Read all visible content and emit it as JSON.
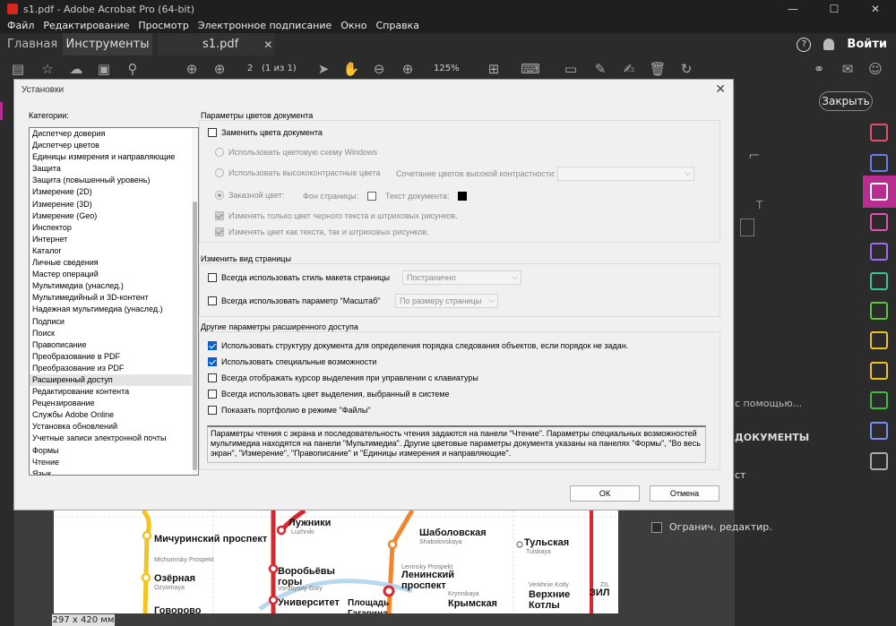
{
  "window": {
    "title": "s1.pdf - Adobe Acrobat Pro (64-bit)",
    "controls": [
      "—",
      "☐",
      "✕"
    ]
  },
  "menu": [
    "Файл",
    "Редактирование",
    "Просмотр",
    "Электронное подписание",
    "Окно",
    "Справка"
  ],
  "tabs": {
    "home": "Главная",
    "tools": "Инструменты",
    "file": "s1.pdf",
    "file_close": "✕",
    "help": "?",
    "signin": "Войти"
  },
  "toolbar": {
    "page_number": "2",
    "page_count": "(1 из 1)",
    "zoom": "125%"
  },
  "right_pane": {
    "close_label": "Закрыть",
    "text_search_hint": "с помощью...",
    "section_heading": "ДОКУМЕНТЫ",
    "item_partial": "ст",
    "restrict_edit": "Огранич. редактир."
  },
  "document": {
    "page_size": "297 x 420 мм",
    "stations": [
      {
        "name": "Мичуринский проспект",
        "sub": "Michurinsky Prospekt"
      },
      {
        "name": "Озёрная",
        "sub": "Ozyornaya"
      },
      {
        "name": "Говорово",
        "sub": ""
      },
      {
        "name": "Лужники",
        "sub": "Luzhniki"
      },
      {
        "name": "Воробьёвы горы",
        "sub": "Vorobyovy Gory"
      },
      {
        "name": "Университет",
        "sub": ""
      },
      {
        "name": "Шаболовская",
        "sub": "Shabolovskaya"
      },
      {
        "name": "Ленинский проспект",
        "sub": "Leninsky Prospekt"
      },
      {
        "name": "Площадь Гагарина",
        "sub": ""
      },
      {
        "name": "Крымская",
        "sub": "Krymskaya"
      },
      {
        "name": "Тульская",
        "sub": "Tulskaya"
      },
      {
        "name": "Верхние Котлы",
        "sub": "Verkhnie Kotly"
      },
      {
        "name": "ЗИЛ",
        "sub": "ZIL"
      }
    ]
  },
  "dialog": {
    "title": "Установки",
    "close": "✕",
    "categories_label": "Категории:",
    "categories": [
      "Диспетчер доверия",
      "Диспетчер цветов",
      "Единицы измерения и направляющие",
      "Защита",
      "Защита (повышенный уровень)",
      "Измерение (2D)",
      "Измерение (3D)",
      "Измерение (Geo)",
      "Инспектор",
      "Интернет",
      "Каталог",
      "Личные сведения",
      "Мастер операций",
      "Мультимедиа (унаслед.)",
      "Мультимедийный и 3D-контент",
      "Надежная мультимедиа (унаслед.)",
      "Подписи",
      "Поиск",
      "Правописание",
      "Преобразование в PDF",
      "Преобразование из PDF",
      "Расширенный доступ",
      "Редактирование контента",
      "Рецензирование",
      "Службы Adobe Online",
      "Установка обновлений",
      "Учетные записи электронной почты",
      "Формы",
      "Чтение",
      "Язык"
    ],
    "selected_category": "Расширенный доступ",
    "color_group": {
      "title": "Параметры цветов документа",
      "replace_colors": "Заменить цвета документа",
      "windows_scheme": "Использовать цветовую схему Windows",
      "high_contrast": "Использовать высококонтрастные цвета",
      "hc_combo_label": "Сочетание цветов высокой контрастности:",
      "hc_combo_value": "",
      "custom_color": "Заказной цвет:",
      "page_bg_label": "Фон страницы:",
      "doc_text_label": "Текст документа:",
      "page_bg_color": "#ffffff",
      "doc_text_color": "#000000",
      "only_black_text": "Изменять только цвет черного текста и штриховых рисунков.",
      "text_and_lines": "Изменять цвет как текста, так и штриховых рисунков."
    },
    "view_group": {
      "title": "Изменить вид страницы",
      "always_layout": "Всегда использовать стиль макета страницы",
      "layout_value": "Постранично",
      "always_zoom": "Всегда использовать параметр \"Масштаб\"",
      "zoom_value": "По размеру страницы"
    },
    "other_group": {
      "title": "Другие параметры расширенного доступа",
      "items": [
        {
          "label": "Использовать структуру документа для определения порядка следования объектов, если порядок не задан.",
          "checked": true
        },
        {
          "label": "Использовать специальные возможности",
          "checked": true
        },
        {
          "label": "Всегда отображать курсор выделения при управлении с клавиатуры",
          "checked": false
        },
        {
          "label": "Всегда использовать цвет выделения, выбранный в системе",
          "checked": false
        },
        {
          "label": "Показать портфолио в режиме \"Файлы\"",
          "checked": false
        }
      ],
      "info": "Параметры чтения с экрана и последовательность чтения задаются на панели \"Чтение\". Параметры специальных возможностей мультимедиа находятся на панели \"Мультимедиа\". Другие цветовые параметры документа указаны на панелях \"Формы\", \"Во весь экран\", \"Измерение\", \"Правописание\" и \"Единицы измерения и направляющие\"."
    },
    "ok": "ОК",
    "cancel": "Отмена"
  },
  "colors": {
    "accent_checkbox": "#0b5fd2",
    "active_tool": "#ba2d90",
    "metro_red": "#d8282e",
    "metro_orange": "#f3852c",
    "metro_yellow": "#f6c21e"
  }
}
